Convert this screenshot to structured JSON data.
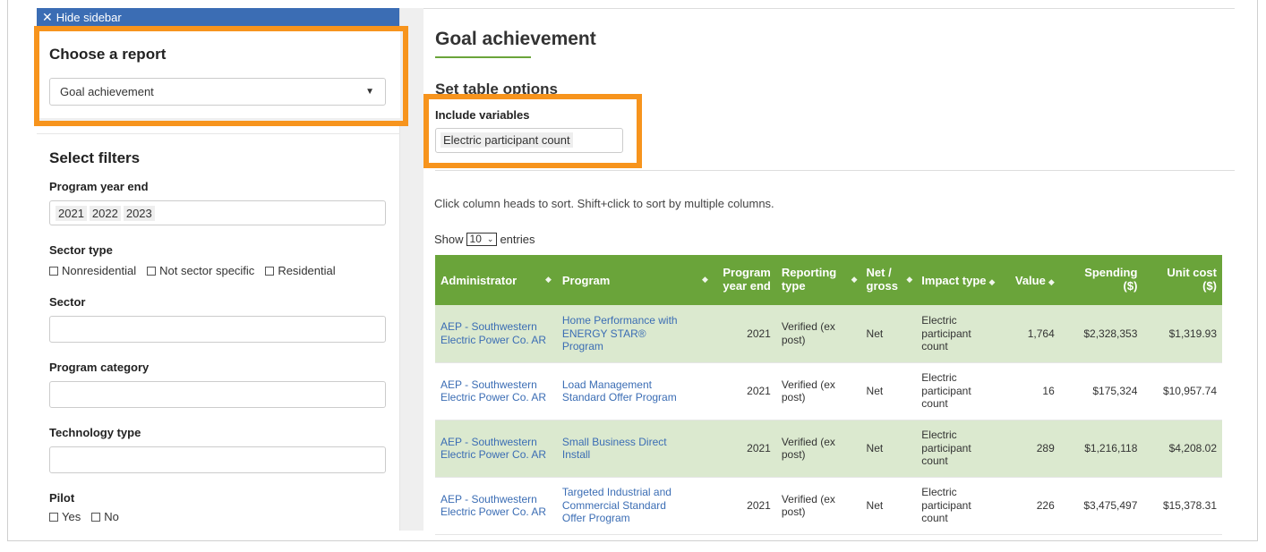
{
  "sidebar": {
    "hide_label": "Hide sidebar",
    "report_heading": "Choose a report",
    "report_selected": "Goal achievement",
    "filters_heading": "Select filters",
    "program_year_label": "Program year end",
    "program_years": [
      "2021",
      "2022",
      "2023"
    ],
    "sector_type_label": "Sector type",
    "sector_types": [
      "Nonresidential",
      "Not sector specific",
      "Residential"
    ],
    "sector_label": "Sector",
    "program_category_label": "Program category",
    "technology_type_label": "Technology type",
    "pilot_label": "Pilot",
    "pilot_options": [
      "Yes",
      "No"
    ]
  },
  "main": {
    "title": "Goal achievement",
    "table_options_heading": "Set table options",
    "include_variables_label": "Include variables",
    "include_variables_value": "Electric participant count",
    "sort_hint": "Click column heads to sort. Shift+click to sort by multiple columns.",
    "show_label": "Show",
    "entries_value": "10",
    "entries_label": "entries"
  },
  "table": {
    "headers": {
      "administrator": "Administrator",
      "program": "Program",
      "program_year_end_1": "Program",
      "program_year_end_2": "year end",
      "reporting_type_1": "Reporting",
      "reporting_type_2": "type",
      "net_gross_1": "Net /",
      "net_gross_2": "gross",
      "impact_type": "Impact type",
      "value": "Value",
      "spending_1": "Spending",
      "spending_2": "($)",
      "unit_cost_1": "Unit cost",
      "unit_cost_2": "($)"
    },
    "rows": [
      {
        "admin_1": "AEP - Southwestern",
        "admin_2": "Electric Power Co. AR",
        "program_1": "Home Performance with",
        "program_2": "ENERGY STAR®",
        "program_3": "Program",
        "year": "2021",
        "reporting_1": "Verified (ex",
        "reporting_2": "post)",
        "net": "Net",
        "impact_1": "Electric",
        "impact_2": "participant",
        "impact_3": "count",
        "value": "1,764",
        "spending": "$2,328,353",
        "unit_cost": "$1,319.93"
      },
      {
        "admin_1": "AEP - Southwestern",
        "admin_2": "Electric Power Co. AR",
        "program_1": "Load Management",
        "program_2": "Standard Offer Program",
        "program_3": "",
        "year": "2021",
        "reporting_1": "Verified (ex",
        "reporting_2": "post)",
        "net": "Net",
        "impact_1": "Electric",
        "impact_2": "participant",
        "impact_3": "count",
        "value": "16",
        "spending": "$175,324",
        "unit_cost": "$10,957.74"
      },
      {
        "admin_1": "AEP - Southwestern",
        "admin_2": "Electric Power Co. AR",
        "program_1": "Small Business Direct",
        "program_2": "Install",
        "program_3": "",
        "year": "2021",
        "reporting_1": "Verified (ex",
        "reporting_2": "post)",
        "net": "Net",
        "impact_1": "Electric",
        "impact_2": "participant",
        "impact_3": "count",
        "value": "289",
        "spending": "$1,216,118",
        "unit_cost": "$4,208.02"
      },
      {
        "admin_1": "AEP - Southwestern",
        "admin_2": "Electric Power Co. AR",
        "program_1": "Targeted Industrial and",
        "program_2": "Commercial Standard",
        "program_3": "Offer Program",
        "year": "2021",
        "reporting_1": "Verified (ex",
        "reporting_2": "post)",
        "net": "Net",
        "impact_1": "Electric",
        "impact_2": "participant",
        "impact_3": "count",
        "value": "226",
        "spending": "$3,475,497",
        "unit_cost": "$15,378.31"
      }
    ]
  },
  "colors": {
    "accent_green": "#6aa43a",
    "row_green": "#dbe9cf",
    "sidebar_blue": "#3b6db4",
    "highlight_orange": "#f7941d",
    "link_blue": "#3b6db4"
  }
}
